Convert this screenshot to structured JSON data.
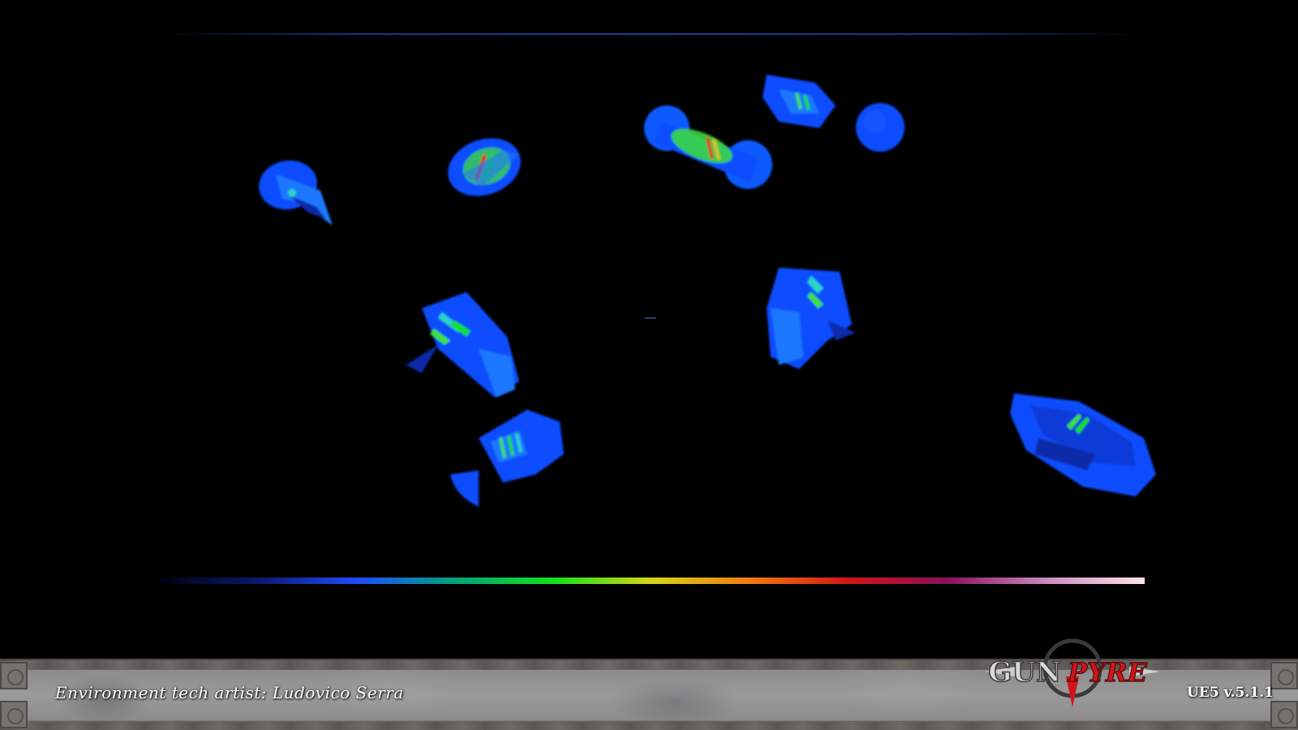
{
  "footer": {
    "credit": "Environment tech artist: Ludovico Serra",
    "version": "UE5 v.5.1.1"
  },
  "logo": {
    "text_part1": "GUN",
    "text_part2": "PYRE"
  },
  "colors": {
    "background": "#000000",
    "mesh_blue": "#0a4dff",
    "mesh_light_blue": "#1e78ff",
    "mesh_dark_blue": "#0a2aa8",
    "mesh_green": "#3de23a",
    "mesh_red": "#e0301c",
    "logo_silver": "#d8d8d8",
    "logo_red": "#d3131c"
  },
  "scale_legend": {
    "stops": [
      "#000010",
      "#0a1a6b",
      "#1f4bff",
      "#00a37a",
      "#12e01b",
      "#d4d41a",
      "#f07a10",
      "#d21414",
      "#8a0f5c",
      "#c98ac0",
      "#ffe4ea"
    ]
  }
}
